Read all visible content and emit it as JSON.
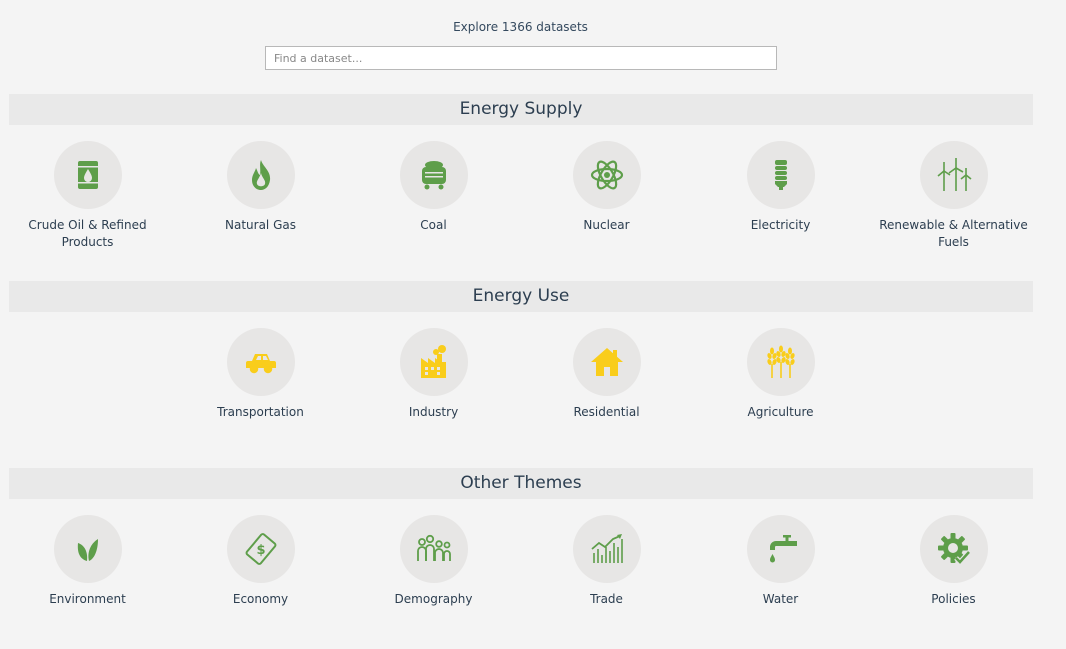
{
  "header": {
    "explore_text": "Explore 1366 datasets",
    "search_placeholder": "Find a dataset..."
  },
  "colors": {
    "supply_icon": "#5e9e4a",
    "use_icon": "#f9cd1b",
    "circle_bg": "#e7e6e5",
    "section_bg": "#e9e9e9"
  },
  "sections": [
    {
      "title": "Energy Supply",
      "items": [
        {
          "label": "Crude Oil & Refined Products",
          "icon": "oil-barrel-icon"
        },
        {
          "label": "Natural Gas",
          "icon": "flame-icon"
        },
        {
          "label": "Coal",
          "icon": "coal-cart-icon"
        },
        {
          "label": "Nuclear",
          "icon": "atom-icon"
        },
        {
          "label": "Electricity",
          "icon": "light-bulb-icon"
        },
        {
          "label": "Renewable & Alternative Fuels",
          "icon": "wind-turbine-icon"
        }
      ]
    },
    {
      "title": "Energy Use",
      "items": [
        {
          "label": "Transportation",
          "icon": "car-icon"
        },
        {
          "label": "Industry",
          "icon": "factory-icon"
        },
        {
          "label": "Residential",
          "icon": "house-icon"
        },
        {
          "label": "Agriculture",
          "icon": "wheat-icon"
        }
      ]
    },
    {
      "title": "Other Themes",
      "items": [
        {
          "label": "Environment",
          "icon": "leaf-icon"
        },
        {
          "label": "Economy",
          "icon": "money-icon"
        },
        {
          "label": "Demography",
          "icon": "people-icon"
        },
        {
          "label": "Trade",
          "icon": "trade-chart-icon"
        },
        {
          "label": "Water",
          "icon": "water-tap-icon"
        },
        {
          "label": "Policies",
          "icon": "gear-check-icon"
        }
      ]
    }
  ]
}
